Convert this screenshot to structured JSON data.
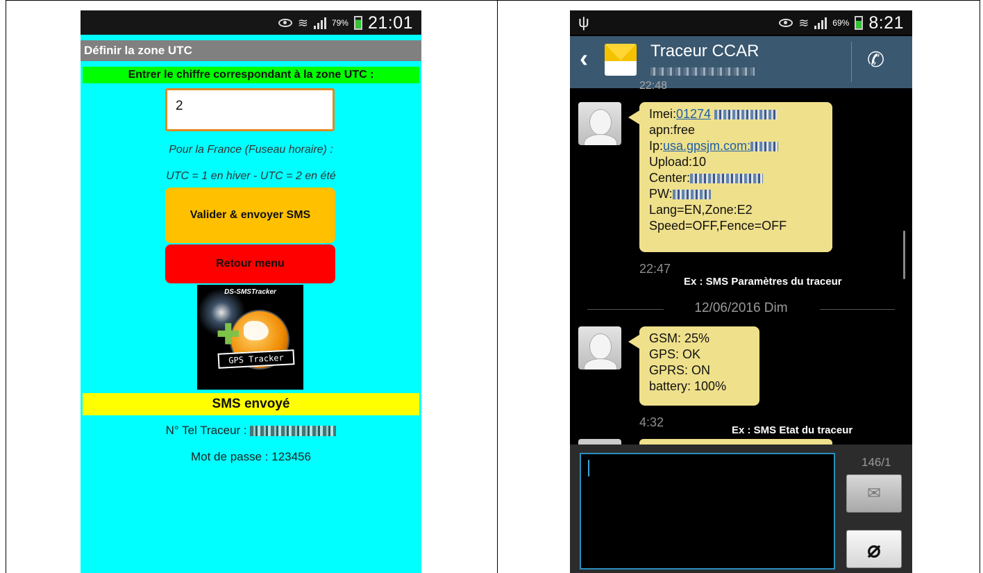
{
  "left_phone": {
    "status_bar": {
      "battery_percent": "79%",
      "time": "21:01"
    },
    "title": "Définir la zone UTC",
    "prompt": "Entrer le chiffre correspondant à la zone UTC :",
    "utc_input_value": "2",
    "note_line1": "Pour la France (Fuseau horaire) :",
    "note_line2": "UTC = 1 en hiver - UTC = 2 en été",
    "validate_button": "Valider & envoyer SMS",
    "return_button": "Retour menu",
    "logo": {
      "top_text": "DS-SMSTracker",
      "badge_text": "GPS Tracker"
    },
    "status_message": "SMS envoyé",
    "tracker_phone_label": "N° Tel Traceur :",
    "password_label": "Mot de passe :",
    "password_value": "123456"
  },
  "right_phone": {
    "status_bar": {
      "battery_percent": "69%",
      "time": "8:21"
    },
    "contact_name": "Traceur CCAR",
    "partial_timestamp": "22:48",
    "message1": {
      "imei_label": "Imei:",
      "imei_value": "01274",
      "apn": "apn:free",
      "ip_label": "Ip:",
      "ip_value": "usa.gpsjm.com:",
      "upload": "Upload:10",
      "center_label": "Center:",
      "pw_label": "PW:",
      "lang_zone": "Lang=EN,Zone:E2",
      "speed_fence": "Speed=OFF,Fence=OFF",
      "time": "22:47",
      "caption": "Ex : SMS Paramètres du traceur"
    },
    "date_separator": "12/06/2016 Dim",
    "message2": {
      "gsm": "GSM: 25%",
      "gps": "GPS: OK",
      "gprs": "GPRS: ON",
      "battery": "battery: 100%",
      "time": "4:32",
      "caption": "Ex : SMS Etat du traceur"
    },
    "char_counter": "146/1"
  },
  "colors": {
    "left_background": "#00ffff",
    "prompt_bar": "#00ff00",
    "validate_button": "#ffc000",
    "return_button": "#ff0000",
    "status_bar_yellow": "#ffff00",
    "bubble": "#efe08b",
    "header_blue": "#3a5870"
  }
}
